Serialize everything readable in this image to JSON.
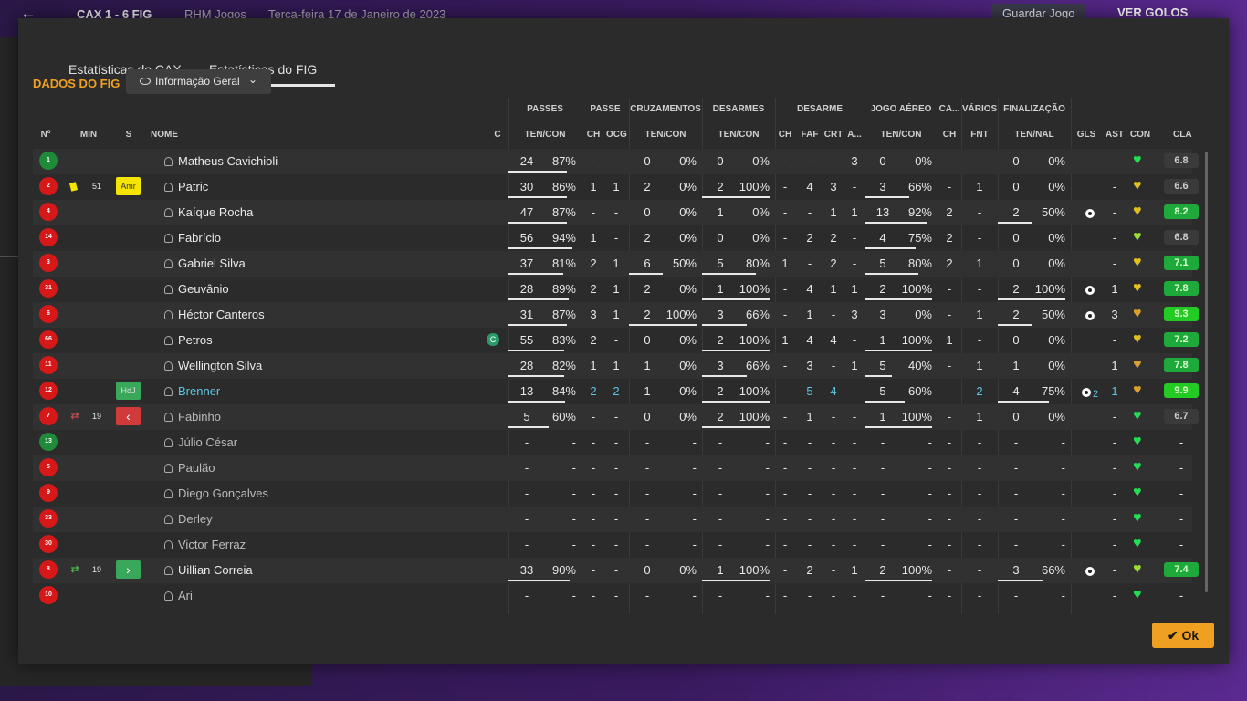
{
  "topbar": {
    "back_icon": "arrow-left-icon",
    "score": "CAX 1 - 6 FIG",
    "org": "RHM Jogos",
    "date": "Terça-feira 17 de Janeiro de 2023",
    "save": "Guardar Jogo",
    "goals": "VER GOLOS"
  },
  "tabs": [
    "Estatísticas do CAX",
    "Estatísticas do FIG"
  ],
  "section_title": "DADOS DO FIG",
  "dropdown": {
    "label": "Informação Geral"
  },
  "groups": {
    "passes": "PASSES",
    "passe": "PASSE",
    "cruzamentos": "CRUZAMENTOS",
    "desarmes": "DESARMES",
    "desarme": "DESARME",
    "jogo_aereo": "JOGO AÉREO",
    "ca": "CA...",
    "varios": "VÁRIOS",
    "finalizacao": "FINALIZAÇÃO"
  },
  "headers": {
    "no": "Nº",
    "min": "MIN",
    "s": "S",
    "nome": "NOME",
    "c": "C",
    "passes_tc": "TEN/CON",
    "ch": "CH",
    "ocg": "OCG",
    "cruz_tc": "TEN/CON",
    "des_tc": "TEN/CON",
    "dch": "CH",
    "faf": "FAF",
    "crt": "CRT",
    "a": "A...",
    "aer_tc": "TEN/CON",
    "cach": "CH",
    "fnt": "FNT",
    "fin_tn": "TEN/NAL",
    "gls": "GLS",
    "ast": "AST",
    "con": "CON",
    "cla": "CLA"
  },
  "ok_label": "Ok",
  "players": [
    {
      "no": "1",
      "shirt": "green",
      "min": "",
      "s": "",
      "name": "Matheus Cavichioli",
      "card": false,
      "c": "",
      "p_ten": "24",
      "p_pct": "87%",
      "p_fill": 0.87,
      "ch": "-",
      "ocg": "-",
      "cr_ten": "0",
      "cr_pct": "0%",
      "cr_fill": 0,
      "de_ten": "0",
      "de_pct": "0%",
      "de_fill": 0,
      "dch": "-",
      "faf": "-",
      "crt": "-",
      "a": "3",
      "ae_ten": "0",
      "ae_pct": "0%",
      "ae_fill": 0,
      "cach": "-",
      "fnt": "-",
      "fi_ten": "0",
      "fi_pct": "0%",
      "fi_fill": 0,
      "gls": "",
      "ast": "-",
      "heart": "green",
      "rating": "6.8",
      "rstyle": "grey",
      "style": ""
    },
    {
      "no": "2",
      "shirt": "red",
      "min": "51",
      "s": "Amr",
      "sstyle": "amr",
      "name": "Patric",
      "card": true,
      "c": "",
      "p_ten": "30",
      "p_pct": "86%",
      "p_fill": 0.86,
      "ch": "1",
      "ocg": "1",
      "cr_ten": "2",
      "cr_pct": "0%",
      "cr_fill": 0,
      "de_ten": "2",
      "de_pct": "100%",
      "de_fill": 1,
      "dch": "-",
      "faf": "4",
      "crt": "3",
      "a": "-",
      "ae_ten": "3",
      "ae_pct": "66%",
      "ae_fill": 0.66,
      "cach": "-",
      "fnt": "1",
      "fi_ten": "0",
      "fi_pct": "0%",
      "fi_fill": 0,
      "gls": "",
      "ast": "-",
      "heart": "yellow",
      "rating": "6.6",
      "rstyle": "grey",
      "style": ""
    },
    {
      "no": "4",
      "shirt": "red",
      "min": "",
      "s": "",
      "name": "Kaíque Rocha",
      "card": false,
      "c": "",
      "p_ten": "47",
      "p_pct": "87%",
      "p_fill": 0.87,
      "ch": "-",
      "ocg": "-",
      "cr_ten": "0",
      "cr_pct": "0%",
      "cr_fill": 0,
      "de_ten": "1",
      "de_pct": "0%",
      "de_fill": 0,
      "dch": "-",
      "faf": "-",
      "crt": "1",
      "a": "1",
      "ae_ten": "13",
      "ae_pct": "92%",
      "ae_fill": 0.92,
      "cach": "2",
      "fnt": "-",
      "fi_ten": "2",
      "fi_pct": "50%",
      "fi_fill": 0.5,
      "gls": "ball",
      "ast": "-",
      "heart": "yellow",
      "rating": "8.2",
      "rstyle": "green",
      "style": ""
    },
    {
      "no": "14",
      "shirt": "red",
      "min": "",
      "s": "",
      "name": "Fabrício",
      "card": false,
      "c": "",
      "p_ten": "56",
      "p_pct": "94%",
      "p_fill": 0.94,
      "ch": "1",
      "ocg": "-",
      "cr_ten": "2",
      "cr_pct": "0%",
      "cr_fill": 0,
      "de_ten": "0",
      "de_pct": "0%",
      "de_fill": 0,
      "dch": "-",
      "faf": "2",
      "crt": "2",
      "a": "-",
      "ae_ten": "4",
      "ae_pct": "75%",
      "ae_fill": 0.75,
      "cach": "2",
      "fnt": "-",
      "fi_ten": "0",
      "fi_pct": "0%",
      "fi_fill": 0,
      "gls": "",
      "ast": "-",
      "heart": "lime",
      "rating": "6.8",
      "rstyle": "grey",
      "style": ""
    },
    {
      "no": "3",
      "shirt": "red",
      "min": "",
      "s": "",
      "name": "Gabriel Silva",
      "card": false,
      "c": "",
      "p_ten": "37",
      "p_pct": "81%",
      "p_fill": 0.81,
      "ch": "2",
      "ocg": "1",
      "cr_ten": "6",
      "cr_pct": "50%",
      "cr_fill": 0.5,
      "de_ten": "5",
      "de_pct": "80%",
      "de_fill": 0.8,
      "dch": "1",
      "faf": "-",
      "crt": "2",
      "a": "-",
      "ae_ten": "5",
      "ae_pct": "80%",
      "ae_fill": 0.8,
      "cach": "2",
      "fnt": "1",
      "fi_ten": "0",
      "fi_pct": "0%",
      "fi_fill": 0,
      "gls": "",
      "ast": "-",
      "heart": "yellow",
      "rating": "7.1",
      "rstyle": "green",
      "style": ""
    },
    {
      "no": "31",
      "shirt": "red",
      "min": "",
      "s": "",
      "name": "Geuvânio",
      "card": false,
      "c": "",
      "p_ten": "28",
      "p_pct": "89%",
      "p_fill": 0.89,
      "ch": "2",
      "ocg": "1",
      "cr_ten": "2",
      "cr_pct": "0%",
      "cr_fill": 0,
      "de_ten": "1",
      "de_pct": "100%",
      "de_fill": 1,
      "dch": "-",
      "faf": "4",
      "crt": "1",
      "a": "1",
      "ae_ten": "2",
      "ae_pct": "100%",
      "ae_fill": 1,
      "cach": "-",
      "fnt": "-",
      "fi_ten": "2",
      "fi_pct": "100%",
      "fi_fill": 1,
      "gls": "ball",
      "ast": "1",
      "heart": "yellow",
      "rating": "7.8",
      "rstyle": "green",
      "style": ""
    },
    {
      "no": "6",
      "shirt": "red",
      "min": "",
      "s": "",
      "name": "Héctor Canteros",
      "card": false,
      "c": "",
      "p_ten": "31",
      "p_pct": "87%",
      "p_fill": 0.87,
      "ch": "3",
      "ocg": "1",
      "cr_ten": "2",
      "cr_pct": "100%",
      "cr_fill": 1,
      "de_ten": "3",
      "de_pct": "66%",
      "de_fill": 0.66,
      "dch": "-",
      "faf": "1",
      "crt": "-",
      "a": "3",
      "ae_ten": "3",
      "ae_pct": "0%",
      "ae_fill": 0,
      "cach": "-",
      "fnt": "1",
      "fi_ten": "2",
      "fi_pct": "50%",
      "fi_fill": 0.5,
      "gls": "ball",
      "ast": "3",
      "heart": "orange",
      "rating": "9.3",
      "rstyle": "bright",
      "style": ""
    },
    {
      "no": "66",
      "shirt": "red",
      "min": "",
      "s": "",
      "name": "Petros",
      "card": false,
      "c": "C",
      "p_ten": "55",
      "p_pct": "83%",
      "p_fill": 0.83,
      "ch": "2",
      "ocg": "-",
      "cr_ten": "0",
      "cr_pct": "0%",
      "cr_fill": 0,
      "de_ten": "2",
      "de_pct": "100%",
      "de_fill": 1,
      "dch": "1",
      "faf": "4",
      "crt": "4",
      "a": "-",
      "ae_ten": "1",
      "ae_pct": "100%",
      "ae_fill": 1,
      "cach": "1",
      "fnt": "-",
      "fi_ten": "0",
      "fi_pct": "0%",
      "fi_fill": 0,
      "gls": "",
      "ast": "-",
      "heart": "yellow",
      "rating": "7.2",
      "rstyle": "green",
      "style": ""
    },
    {
      "no": "11",
      "shirt": "red",
      "min": "",
      "s": "",
      "name": "Wellington Silva",
      "card": false,
      "c": "",
      "p_ten": "28",
      "p_pct": "82%",
      "p_fill": 0.82,
      "ch": "1",
      "ocg": "1",
      "cr_ten": "1",
      "cr_pct": "0%",
      "cr_fill": 0,
      "de_ten": "3",
      "de_pct": "66%",
      "de_fill": 0.66,
      "dch": "-",
      "faf": "3",
      "crt": "-",
      "a": "1",
      "ae_ten": "5",
      "ae_pct": "40%",
      "ae_fill": 0.4,
      "cach": "-",
      "fnt": "1",
      "fi_ten": "1",
      "fi_pct": "0%",
      "fi_fill": 0,
      "gls": "",
      "ast": "1",
      "heart": "orange",
      "rating": "7.8",
      "rstyle": "green",
      "style": ""
    },
    {
      "no": "12",
      "shirt": "red",
      "min": "",
      "s": "HdJ",
      "sstyle": "hdj",
      "name": "Brenner",
      "card": false,
      "c": "",
      "p_ten": "13",
      "p_pct": "84%",
      "p_fill": 0.84,
      "ch": "2",
      "ocg": "2",
      "cr_ten": "1",
      "cr_pct": "0%",
      "cr_fill": 0,
      "de_ten": "2",
      "de_pct": "100%",
      "de_fill": 1,
      "dch": "-",
      "faf": "5",
      "crt": "4",
      "a": "-",
      "ae_ten": "5",
      "ae_pct": "60%",
      "ae_fill": 0.6,
      "cach": "-",
      "fnt": "2",
      "fi_ten": "4",
      "fi_pct": "75%",
      "fi_fill": 0.75,
      "gls": "ball2",
      "ast": "1",
      "heart": "orange",
      "rating": "9.9",
      "rstyle": "bright",
      "style": "blue"
    },
    {
      "no": "7",
      "shirt": "red",
      "min": "19",
      "s": "out",
      "sstyle": "out",
      "name": "Fabinho",
      "card": false,
      "swap": "red",
      "c": "",
      "p_ten": "5",
      "p_pct": "60%",
      "p_fill": 0.6,
      "ch": "-",
      "ocg": "-",
      "cr_ten": "0",
      "cr_pct": "0%",
      "cr_fill": 0,
      "de_ten": "2",
      "de_pct": "100%",
      "de_fill": 1,
      "dch": "-",
      "faf": "1",
      "crt": "-",
      "a": "-",
      "ae_ten": "1",
      "ae_pct": "100%",
      "ae_fill": 1,
      "cach": "-",
      "fnt": "1",
      "fi_ten": "0",
      "fi_pct": "0%",
      "fi_fill": 0,
      "gls": "",
      "ast": "-",
      "heart": "green",
      "rating": "6.7",
      "rstyle": "grey",
      "style": "dim"
    },
    {
      "no": "13",
      "shirt": "green",
      "name": "Júlio César",
      "empty": true,
      "heart": "green",
      "style": "dim"
    },
    {
      "no": "5",
      "shirt": "red",
      "name": "Paulão",
      "empty": true,
      "heart": "green",
      "style": "dim"
    },
    {
      "no": "9",
      "shirt": "red",
      "name": "Diego Gonçalves",
      "empty": true,
      "heart": "green",
      "style": "dim"
    },
    {
      "no": "33",
      "shirt": "red",
      "name": "Derley",
      "empty": true,
      "heart": "green",
      "style": "dim"
    },
    {
      "no": "30",
      "shirt": "red",
      "name": "Victor Ferraz",
      "empty": true,
      "heart": "green",
      "style": "dim"
    },
    {
      "no": "8",
      "shirt": "red",
      "min": "19",
      "s": "in",
      "sstyle": "in",
      "name": "Uillian Correia",
      "card": false,
      "swap": "green",
      "c": "",
      "p_ten": "33",
      "p_pct": "90%",
      "p_fill": 0.9,
      "ch": "-",
      "ocg": "-",
      "cr_ten": "0",
      "cr_pct": "0%",
      "cr_fill": 0,
      "de_ten": "1",
      "de_pct": "100%",
      "de_fill": 1,
      "dch": "-",
      "faf": "2",
      "crt": "-",
      "a": "1",
      "ae_ten": "2",
      "ae_pct": "100%",
      "ae_fill": 1,
      "cach": "-",
      "fnt": "-",
      "fi_ten": "3",
      "fi_pct": "66%",
      "fi_fill": 0.66,
      "gls": "ball",
      "ast": "-",
      "heart": "lime",
      "rating": "7.4",
      "rstyle": "green",
      "style": ""
    },
    {
      "no": "10",
      "shirt": "red",
      "name": "Ari",
      "empty": true,
      "heart": "green",
      "style": "dim"
    }
  ],
  "colors": {
    "accent": "#f0a020",
    "green_rating": "#1eaa3a",
    "bright_rating": "#22cc22",
    "blue_name": "#5fc6e6"
  }
}
